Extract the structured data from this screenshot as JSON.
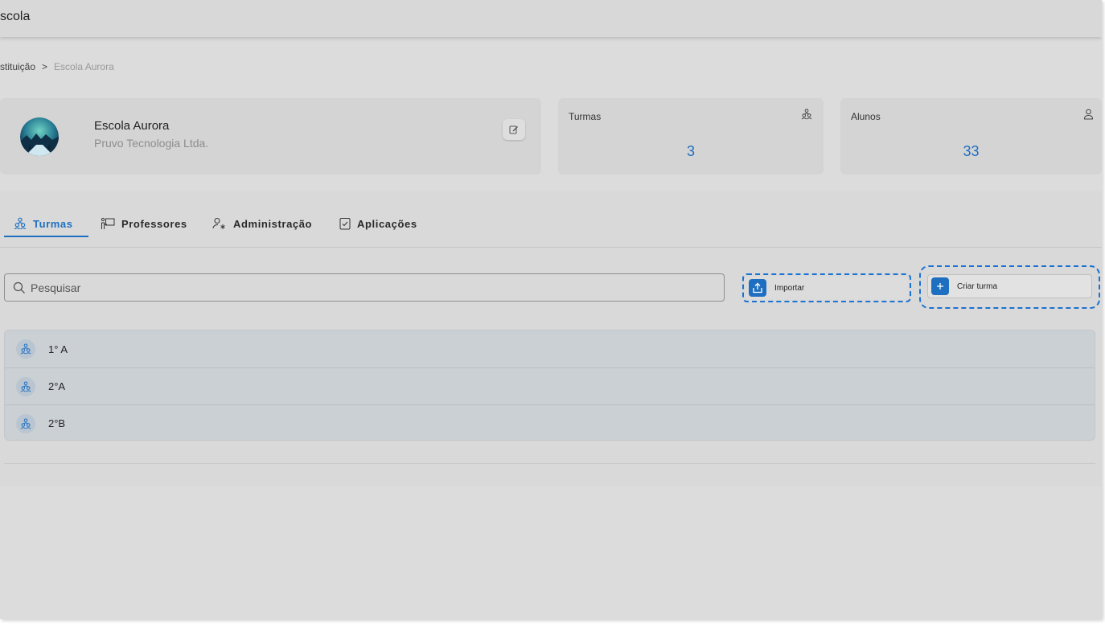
{
  "app": {
    "title": "scola"
  },
  "breadcrumb": {
    "parent": "stituição",
    "separator": ">",
    "current": "Escola Aurora"
  },
  "school": {
    "name": "Escola Aurora",
    "company": "Pruvo Tecnologia Ltda."
  },
  "stats": [
    {
      "label": "Turmas",
      "value": "3",
      "icon": "group-icon"
    },
    {
      "label": "Alunos",
      "value": "33",
      "icon": "person-icon"
    }
  ],
  "tabs": [
    {
      "label": "Turmas",
      "icon": "group-icon",
      "active": true
    },
    {
      "label": "Professores",
      "icon": "teacher-board-icon",
      "active": false
    },
    {
      "label": "Administração",
      "icon": "admin-user-icon",
      "active": false
    },
    {
      "label": "Aplicações",
      "icon": "checklist-icon",
      "active": false
    }
  ],
  "search": {
    "placeholder": "Pesquisar"
  },
  "actions": {
    "import_label": "Importar",
    "create_label": "Criar turma"
  },
  "classes": [
    {
      "name": "1° A"
    },
    {
      "name": "2°A"
    },
    {
      "name": "2°B"
    }
  ],
  "colors": {
    "accent": "#1f6fc1",
    "background": "#dcdcdc",
    "list_bg": "#cbd0d4"
  }
}
